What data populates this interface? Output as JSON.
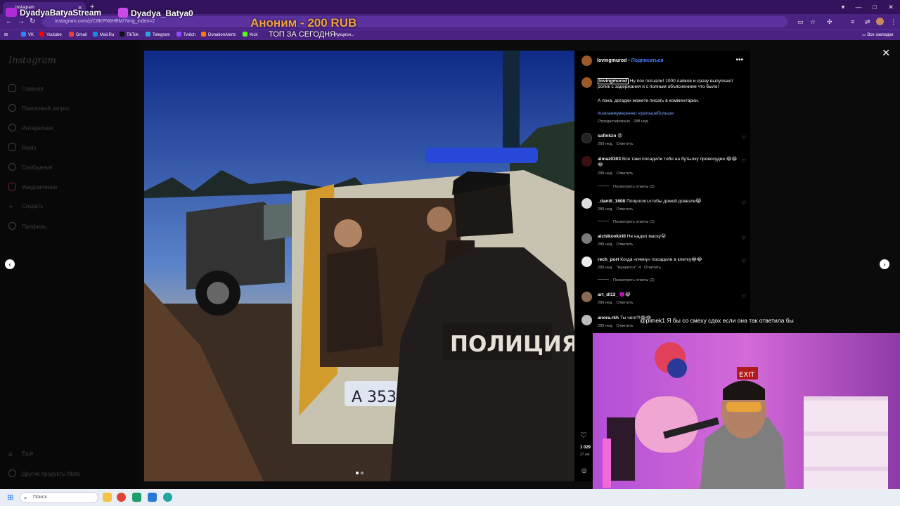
{
  "browser": {
    "tab_title": "Instagram",
    "url": "instagram.com/p/C8KPN6HBM/?img_index=2",
    "bookmarks": [
      "VK",
      "Youtube",
      "Gmail",
      "Mail.Ru",
      "TikTok",
      "Telegram",
      "Twitch",
      "DonationAlerts",
      "Kick",
      "Аукцион..."
    ],
    "all_bookmarks": "Все закладки"
  },
  "stream": {
    "channel_name": "DyadyaBatyaStream",
    "alt_name": "Dyadya_Batya0",
    "donation": "Аноним - 200 RUB",
    "top_label": "ТОП ЗА СЕГОДНЯ",
    "chat_user": "@pimek1",
    "chat_text": "Я бы со смеху сдох если она так ответила бы"
  },
  "sidebar": {
    "logo": "Instagram",
    "items": [
      {
        "label": "Главная",
        "icon": "home-icon"
      },
      {
        "label": "Поисковый запрос",
        "icon": "search-icon"
      },
      {
        "label": "Интересное",
        "icon": "compass-icon"
      },
      {
        "label": "Reels",
        "icon": "reels-icon"
      },
      {
        "label": "Сообщения",
        "icon": "messenger-icon"
      },
      {
        "label": "Уведомления",
        "icon": "heart-icon"
      },
      {
        "label": "Создать",
        "icon": "plus-icon"
      },
      {
        "label": "Профиль",
        "icon": "profile-icon"
      }
    ],
    "more": "Ещё",
    "meta": "Другие продукты Meta"
  },
  "post": {
    "author": "lovingmurod",
    "follow": "Подписаться",
    "caption_user": "lovingmurod",
    "caption": "Ну пох погнали! 1000 лайков и сразу выпускают ролик с задержания и с полным объяснением что было!",
    "caption2": "А пока, догадки можете писать в комментарии.",
    "hashtags": "#шагаемуверенно #дальшебольше",
    "edited": "Отредактировано · 288 нед.",
    "plate": "А 3539",
    "vest_text": "ПОЛИЦИЯ",
    "likes": "1 029",
    "date": "27 ию",
    "reply_label": "Ответить",
    "comments": [
      {
        "user": "safinkzn",
        "text": "😡",
        "age": "289 нед.",
        "replies": ""
      },
      {
        "user": "almaz0303",
        "text": "Все таки посадили тебя на бутылку провосудия 😂😂😂",
        "age": "289 нед.",
        "replies": "Посмотреть ответы (2)"
      },
      {
        "user": "_daniil_1608",
        "text": "Попросил,чтобы домой довезли😹",
        "age": "289 нед.",
        "replies": "Посмотреть ответы (1)"
      },
      {
        "user": "alchikovkirill",
        "text": "Не надел маску😡",
        "age": "289 нед.",
        "replies": ""
      },
      {
        "user": "rech_port",
        "text": "Когда «гиену» посадили в клетку😂😂",
        "age": "289 нед.",
        "likes": "\"Нравится\": 4",
        "replies": "Посмотреть ответы (2)"
      },
      {
        "user": "art_dl13_",
        "text": "👿😹",
        "age": "289 нед.",
        "replies": ""
      },
      {
        "user": "anora.rkh",
        "text": "Ты чего?!😂😂",
        "age": "289 нед.",
        "replies": ""
      }
    ]
  },
  "taskbar": {
    "search": "Поиск"
  }
}
